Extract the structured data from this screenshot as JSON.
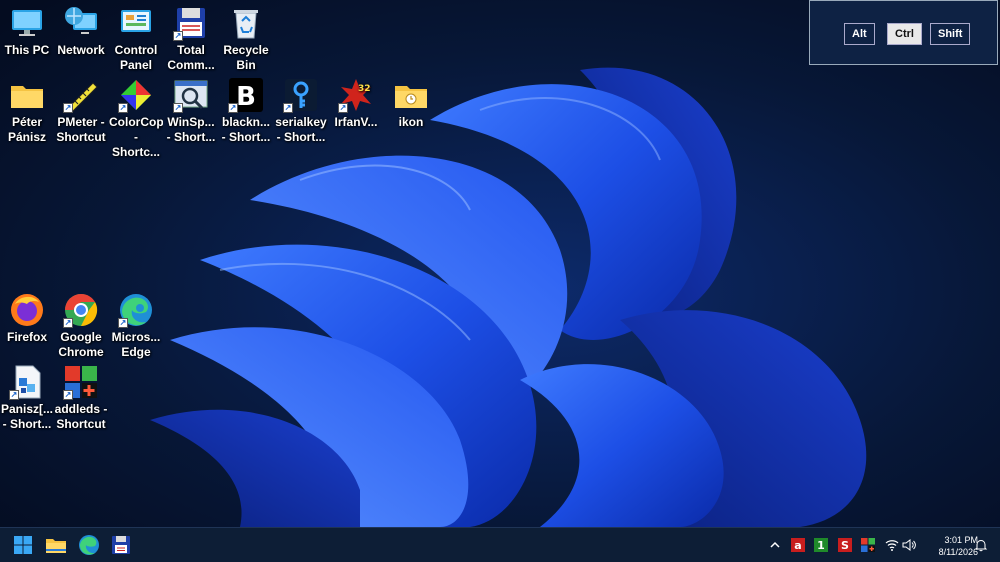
{
  "desktop": {
    "icons": [
      {
        "label": "This PC",
        "icon": "computer-icon"
      },
      {
        "label": "Network",
        "icon": "network-icon"
      },
      {
        "label": "Control\nPanel",
        "icon": "control-panel-icon"
      },
      {
        "label": "Total\nComm...",
        "icon": "total-commander-icon"
      },
      {
        "label": "Recycle\nBin",
        "icon": "recycle-bin-icon"
      },
      {
        "label": "Péter\nPánisz",
        "icon": "folder-icon"
      },
      {
        "label": "PMeter -\nShortcut",
        "icon": "ruler-icon"
      },
      {
        "label": "ColorCop\n- Shortc...",
        "icon": "color-cop-icon"
      },
      {
        "label": "WinSp...\n- Short...",
        "icon": "winspector-icon"
      },
      {
        "label": "blackn...\n- Short...",
        "icon": "blackn-icon"
      },
      {
        "label": "serialkey\n- Short...",
        "icon": "serialkey-icon"
      },
      {
        "label": "IrfanV...",
        "icon": "irfanview-icon"
      },
      {
        "label": "ikon",
        "icon": "folder-clock-icon"
      },
      {
        "label": "Firefox",
        "icon": "firefox-icon"
      },
      {
        "label": "Google\nChrome",
        "icon": "chrome-icon"
      },
      {
        "label": "Micros...\nEdge",
        "icon": "edge-icon"
      },
      {
        "label": "Panisz[...\n- Short...",
        "icon": "panisz-icon"
      },
      {
        "label": "addleds -\nShortcut",
        "icon": "addleds-icon"
      }
    ]
  },
  "modifier_keys": {
    "alt": "Alt",
    "ctrl": "Ctrl",
    "shift": "Shift",
    "active": "Ctrl"
  },
  "taskbar": {
    "start": "windows-start-icon",
    "pinned": [
      "file-explorer-icon",
      "edge-icon",
      "save-icon"
    ],
    "tray": [
      "chevron-up-icon",
      "letter-a-icon",
      "number-one-icon",
      "letter-s-icon",
      "addleds-tray-icon",
      "wifi-icon",
      "volume-icon"
    ],
    "time": "3:01 PM",
    "date": "8/11/2026",
    "notification": "bell-icon"
  },
  "colors": {
    "background": "#06122e",
    "bloom": "#1f55e8",
    "taskbar": "#0d1e36"
  }
}
